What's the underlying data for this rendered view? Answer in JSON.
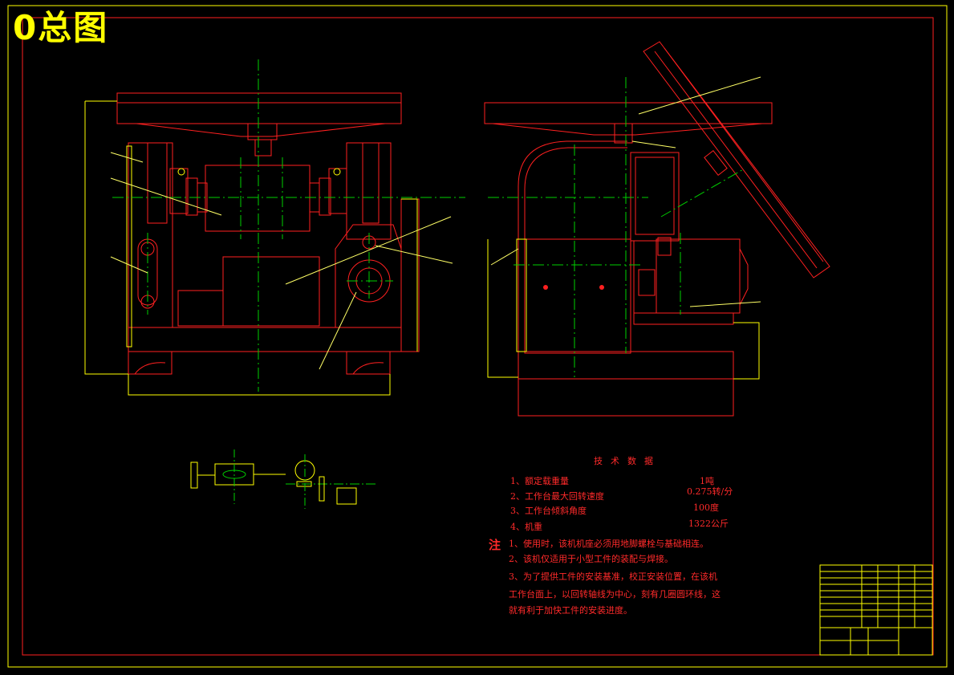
{
  "sheet": {
    "title": "0总图",
    "colors": {
      "background": "#000000",
      "frame": "#ff2020",
      "outline": "#ffff00",
      "center_line": "#00d000",
      "text": "#ff2a2a",
      "leader": "#ffff66"
    }
  },
  "tech_data": {
    "heading": "技术数据",
    "items": [
      {
        "label": "1、额定载重量",
        "value": "1吨"
      },
      {
        "label": "2、工作台最大回转速度",
        "value": "0.275转/分"
      },
      {
        "label": "3、工作台倾斜角度",
        "value": "100度"
      },
      {
        "label": "4、机重",
        "value": "1322公斤"
      }
    ]
  },
  "notes": {
    "marker": "注",
    "lines": [
      "1、使用时，该机机座必须用地脚螺栓与基础相连。",
      "2、该机仅适用于小型工件的装配与焊接。",
      "3、为了提供工件的安装基准，校正安装位置，在该机",
      "工作台面上，以回转轴线为中心，刻有几圈圆环线，这",
      "就有利于加快工件的安装进度。"
    ]
  }
}
